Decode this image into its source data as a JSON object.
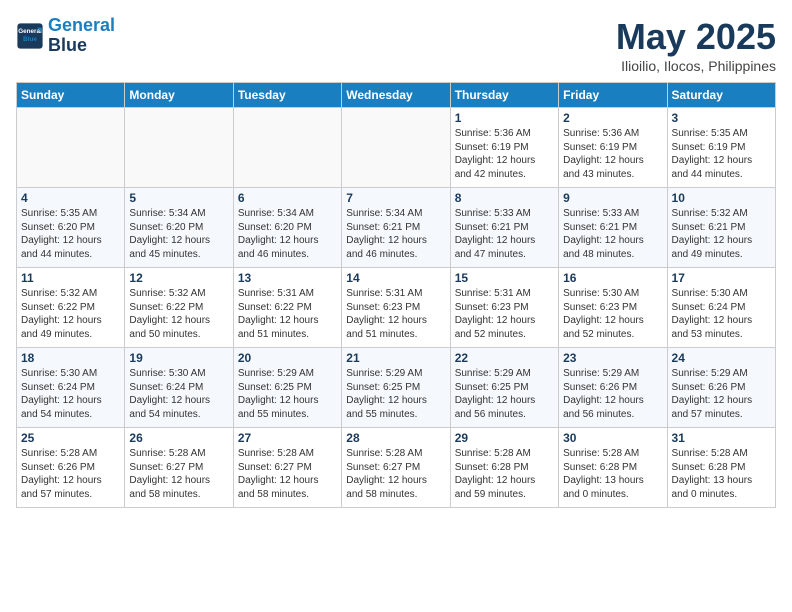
{
  "header": {
    "logo_line1": "General",
    "logo_line2": "Blue",
    "month": "May 2025",
    "location": "Ilioilio, Ilocos, Philippines"
  },
  "weekdays": [
    "Sunday",
    "Monday",
    "Tuesday",
    "Wednesday",
    "Thursday",
    "Friday",
    "Saturday"
  ],
  "weeks": [
    [
      {
        "day": "",
        "info": ""
      },
      {
        "day": "",
        "info": ""
      },
      {
        "day": "",
        "info": ""
      },
      {
        "day": "",
        "info": ""
      },
      {
        "day": "1",
        "info": "Sunrise: 5:36 AM\nSunset: 6:19 PM\nDaylight: 12 hours\nand 42 minutes."
      },
      {
        "day": "2",
        "info": "Sunrise: 5:36 AM\nSunset: 6:19 PM\nDaylight: 12 hours\nand 43 minutes."
      },
      {
        "day": "3",
        "info": "Sunrise: 5:35 AM\nSunset: 6:19 PM\nDaylight: 12 hours\nand 44 minutes."
      }
    ],
    [
      {
        "day": "4",
        "info": "Sunrise: 5:35 AM\nSunset: 6:20 PM\nDaylight: 12 hours\nand 44 minutes."
      },
      {
        "day": "5",
        "info": "Sunrise: 5:34 AM\nSunset: 6:20 PM\nDaylight: 12 hours\nand 45 minutes."
      },
      {
        "day": "6",
        "info": "Sunrise: 5:34 AM\nSunset: 6:20 PM\nDaylight: 12 hours\nand 46 minutes."
      },
      {
        "day": "7",
        "info": "Sunrise: 5:34 AM\nSunset: 6:21 PM\nDaylight: 12 hours\nand 46 minutes."
      },
      {
        "day": "8",
        "info": "Sunrise: 5:33 AM\nSunset: 6:21 PM\nDaylight: 12 hours\nand 47 minutes."
      },
      {
        "day": "9",
        "info": "Sunrise: 5:33 AM\nSunset: 6:21 PM\nDaylight: 12 hours\nand 48 minutes."
      },
      {
        "day": "10",
        "info": "Sunrise: 5:32 AM\nSunset: 6:21 PM\nDaylight: 12 hours\nand 49 minutes."
      }
    ],
    [
      {
        "day": "11",
        "info": "Sunrise: 5:32 AM\nSunset: 6:22 PM\nDaylight: 12 hours\nand 49 minutes."
      },
      {
        "day": "12",
        "info": "Sunrise: 5:32 AM\nSunset: 6:22 PM\nDaylight: 12 hours\nand 50 minutes."
      },
      {
        "day": "13",
        "info": "Sunrise: 5:31 AM\nSunset: 6:22 PM\nDaylight: 12 hours\nand 51 minutes."
      },
      {
        "day": "14",
        "info": "Sunrise: 5:31 AM\nSunset: 6:23 PM\nDaylight: 12 hours\nand 51 minutes."
      },
      {
        "day": "15",
        "info": "Sunrise: 5:31 AM\nSunset: 6:23 PM\nDaylight: 12 hours\nand 52 minutes."
      },
      {
        "day": "16",
        "info": "Sunrise: 5:30 AM\nSunset: 6:23 PM\nDaylight: 12 hours\nand 52 minutes."
      },
      {
        "day": "17",
        "info": "Sunrise: 5:30 AM\nSunset: 6:24 PM\nDaylight: 12 hours\nand 53 minutes."
      }
    ],
    [
      {
        "day": "18",
        "info": "Sunrise: 5:30 AM\nSunset: 6:24 PM\nDaylight: 12 hours\nand 54 minutes."
      },
      {
        "day": "19",
        "info": "Sunrise: 5:30 AM\nSunset: 6:24 PM\nDaylight: 12 hours\nand 54 minutes."
      },
      {
        "day": "20",
        "info": "Sunrise: 5:29 AM\nSunset: 6:25 PM\nDaylight: 12 hours\nand 55 minutes."
      },
      {
        "day": "21",
        "info": "Sunrise: 5:29 AM\nSunset: 6:25 PM\nDaylight: 12 hours\nand 55 minutes."
      },
      {
        "day": "22",
        "info": "Sunrise: 5:29 AM\nSunset: 6:25 PM\nDaylight: 12 hours\nand 56 minutes."
      },
      {
        "day": "23",
        "info": "Sunrise: 5:29 AM\nSunset: 6:26 PM\nDaylight: 12 hours\nand 56 minutes."
      },
      {
        "day": "24",
        "info": "Sunrise: 5:29 AM\nSunset: 6:26 PM\nDaylight: 12 hours\nand 57 minutes."
      }
    ],
    [
      {
        "day": "25",
        "info": "Sunrise: 5:28 AM\nSunset: 6:26 PM\nDaylight: 12 hours\nand 57 minutes."
      },
      {
        "day": "26",
        "info": "Sunrise: 5:28 AM\nSunset: 6:27 PM\nDaylight: 12 hours\nand 58 minutes."
      },
      {
        "day": "27",
        "info": "Sunrise: 5:28 AM\nSunset: 6:27 PM\nDaylight: 12 hours\nand 58 minutes."
      },
      {
        "day": "28",
        "info": "Sunrise: 5:28 AM\nSunset: 6:27 PM\nDaylight: 12 hours\nand 58 minutes."
      },
      {
        "day": "29",
        "info": "Sunrise: 5:28 AM\nSunset: 6:28 PM\nDaylight: 12 hours\nand 59 minutes."
      },
      {
        "day": "30",
        "info": "Sunrise: 5:28 AM\nSunset: 6:28 PM\nDaylight: 13 hours\nand 0 minutes."
      },
      {
        "day": "31",
        "info": "Sunrise: 5:28 AM\nSunset: 6:28 PM\nDaylight: 13 hours\nand 0 minutes."
      }
    ]
  ]
}
